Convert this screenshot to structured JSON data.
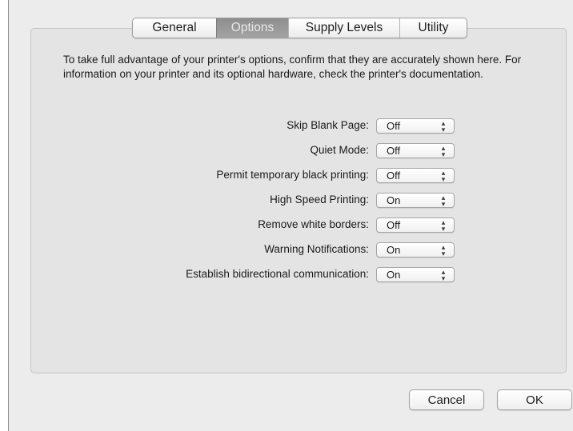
{
  "tabs": [
    {
      "label": "General",
      "active": false
    },
    {
      "label": "Options",
      "active": true
    },
    {
      "label": "Supply Levels",
      "active": false
    },
    {
      "label": "Utility",
      "active": false
    }
  ],
  "description": "To take full advantage of your printer's options, confirm that they are accurately shown here. For information on your printer and its optional hardware, check the printer's documentation.",
  "options": [
    {
      "label": "Skip Blank Page:",
      "value": "Off"
    },
    {
      "label": "Quiet Mode:",
      "value": "Off"
    },
    {
      "label": "Permit temporary black printing:",
      "value": "Off"
    },
    {
      "label": "High Speed Printing:",
      "value": "On"
    },
    {
      "label": "Remove white borders:",
      "value": "Off"
    },
    {
      "label": "Warning Notifications:",
      "value": "On"
    },
    {
      "label": "Establish bidirectional communication:",
      "value": "On"
    }
  ],
  "buttons": {
    "cancel": "Cancel",
    "ok": "OK"
  },
  "colors": {
    "active_tab": "#999999",
    "window_bg": "#ececec",
    "panel_bg": "#e4e4e4"
  }
}
